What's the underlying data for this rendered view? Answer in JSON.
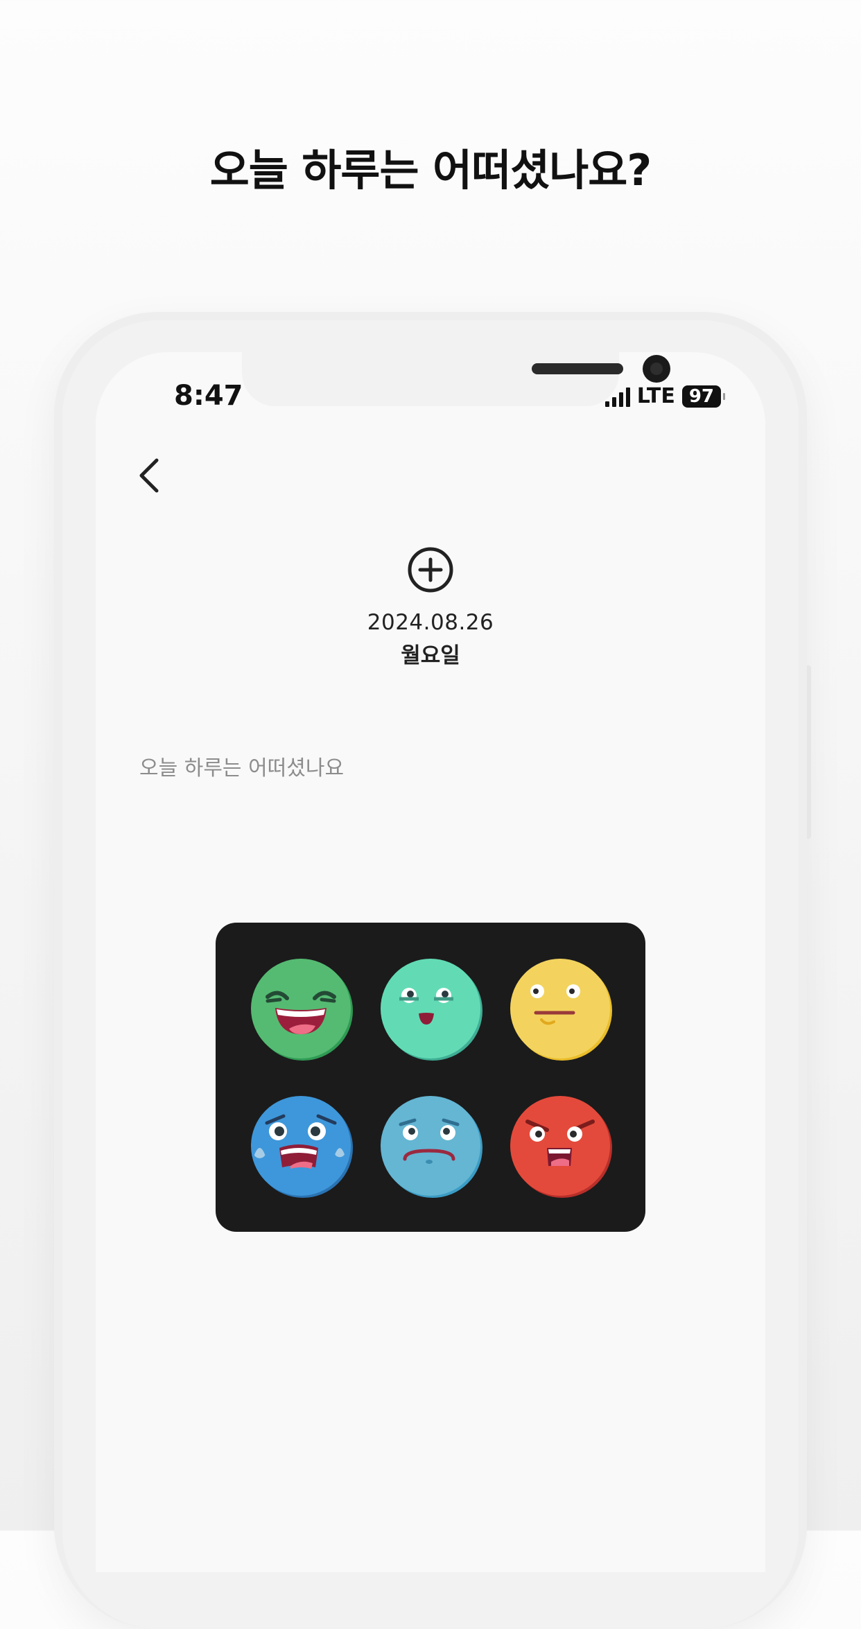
{
  "headline": "오늘 하루는 어떠셨나요?",
  "status_bar": {
    "time": "8:47",
    "network": "LTE",
    "battery": "97"
  },
  "entry": {
    "date": "2024.08.26",
    "weekday": "월요일",
    "prompt": "오늘 하루는 어떠셨나요"
  },
  "moods": [
    {
      "name": "laughing",
      "color": "#4cb86b"
    },
    {
      "name": "happy",
      "color": "#5fd9b3"
    },
    {
      "name": "neutral",
      "color": "#f2d25c"
    },
    {
      "name": "crying",
      "color": "#3b95d6"
    },
    {
      "name": "sad",
      "color": "#5fb3d0"
    },
    {
      "name": "angry",
      "color": "#e34a3c"
    }
  ]
}
